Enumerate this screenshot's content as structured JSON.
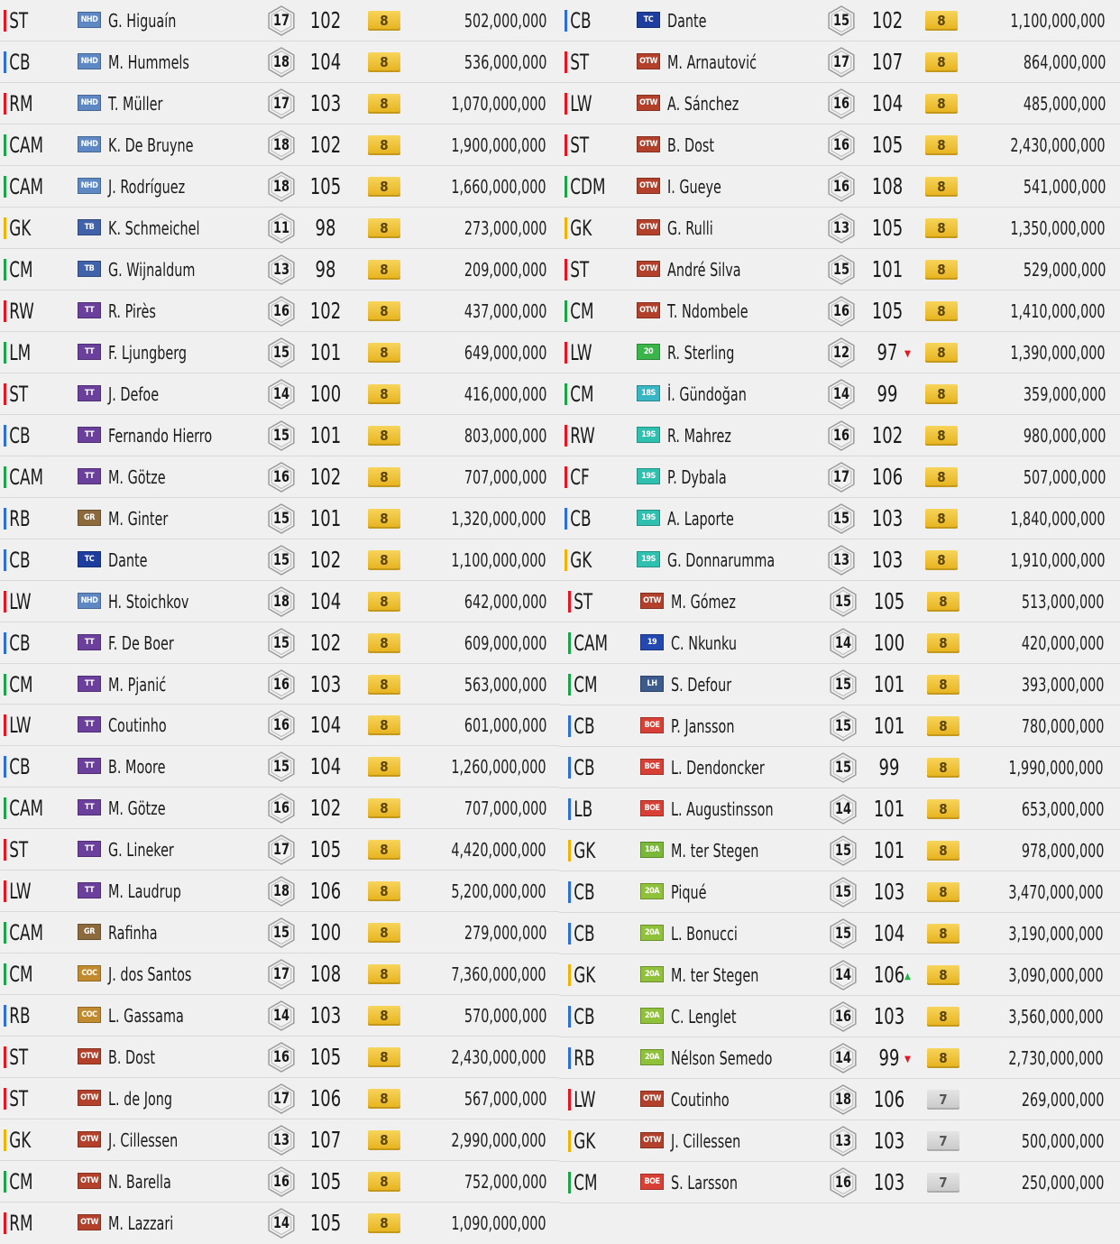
{
  "colors": {
    "position_red": "#e8141f",
    "position_blue": "#2d6fd6",
    "position_green": "#1ea34a",
    "position_yellow": "#f0b400",
    "level_gold": "#e6b21c",
    "level_grey": "#c9c9c9",
    "arrow_down": "#e8141f",
    "arrow_up": "#2ab54a"
  },
  "badge_styles": {
    "NHD": {
      "bg": "#5e88c4"
    },
    "TB": {
      "bg": "#3f62a8"
    },
    "TT": {
      "bg": "#6b3f9c"
    },
    "GR": {
      "bg": "#8c6a3c"
    },
    "TC": {
      "bg": "#1d3e9e"
    },
    "COC": {
      "bg": "#c28a2e"
    },
    "OTW": {
      "bg": "#b3402a"
    },
    "20": {
      "bg": "#3bb54a"
    },
    "18S": {
      "bg": "#38b6c4"
    },
    "19S": {
      "bg": "#2fc0b0"
    },
    "19": {
      "bg": "#2348b0"
    },
    "LH": {
      "bg": "#3c5a8c"
    },
    "BOE": {
      "bg": "#d84035"
    },
    "18A": {
      "bg": "#7ab83a"
    },
    "20A": {
      "bg": "#8fc13a"
    }
  },
  "left_players": [
    {
      "pos": "ST",
      "pc": "red",
      "badge": "NHD",
      "name": "G. Higuaín",
      "lvl": "17",
      "ovr": "102",
      "arrow": "",
      "boost": "8",
      "bc": "gold",
      "price": "502,000,000"
    },
    {
      "pos": "CB",
      "pc": "blue",
      "badge": "NHD",
      "name": "M. Hummels",
      "lvl": "18",
      "ovr": "104",
      "arrow": "",
      "boost": "8",
      "bc": "gold",
      "price": "536,000,000"
    },
    {
      "pos": "RM",
      "pc": "red",
      "badge": "NHD",
      "name": "T. Müller",
      "lvl": "17",
      "ovr": "103",
      "arrow": "",
      "boost": "8",
      "bc": "gold",
      "price": "1,070,000,000"
    },
    {
      "pos": "CAM",
      "pc": "green",
      "badge": "NHD",
      "name": "K. De Bruyne",
      "lvl": "18",
      "ovr": "102",
      "arrow": "",
      "boost": "8",
      "bc": "gold",
      "price": "1,900,000,000"
    },
    {
      "pos": "CAM",
      "pc": "green",
      "badge": "NHD",
      "name": "J. Rodríguez",
      "lvl": "18",
      "ovr": "105",
      "arrow": "",
      "boost": "8",
      "bc": "gold",
      "price": "1,660,000,000"
    },
    {
      "pos": "GK",
      "pc": "yellow",
      "badge": "TB",
      "name": "K. Schmeichel",
      "lvl": "11",
      "ovr": "98",
      "arrow": "",
      "boost": "8",
      "bc": "gold",
      "price": "273,000,000"
    },
    {
      "pos": "CM",
      "pc": "green",
      "badge": "TB",
      "name": "G. Wijnaldum",
      "lvl": "13",
      "ovr": "98",
      "arrow": "",
      "boost": "8",
      "bc": "gold",
      "price": "209,000,000"
    },
    {
      "pos": "RW",
      "pc": "red",
      "badge": "TT",
      "name": "R. Pirès",
      "lvl": "16",
      "ovr": "102",
      "arrow": "",
      "boost": "8",
      "bc": "gold",
      "price": "437,000,000"
    },
    {
      "pos": "LM",
      "pc": "green",
      "badge": "TT",
      "name": "F. Ljungberg",
      "lvl": "15",
      "ovr": "101",
      "arrow": "",
      "boost": "8",
      "bc": "gold",
      "price": "649,000,000"
    },
    {
      "pos": "ST",
      "pc": "red",
      "badge": "TT",
      "name": "J. Defoe",
      "lvl": "14",
      "ovr": "100",
      "arrow": "",
      "boost": "8",
      "bc": "gold",
      "price": "416,000,000"
    },
    {
      "pos": "CB",
      "pc": "blue",
      "badge": "TT",
      "name": "Fernando Hierro",
      "lvl": "15",
      "ovr": "101",
      "arrow": "",
      "boost": "8",
      "bc": "gold",
      "price": "803,000,000"
    },
    {
      "pos": "CAM",
      "pc": "green",
      "badge": "TT",
      "name": "M. Götze",
      "lvl": "16",
      "ovr": "102",
      "arrow": "",
      "boost": "8",
      "bc": "gold",
      "price": "707,000,000"
    },
    {
      "pos": "RB",
      "pc": "blue",
      "badge": "GR",
      "name": "M. Ginter",
      "lvl": "15",
      "ovr": "101",
      "arrow": "",
      "boost": "8",
      "bc": "gold",
      "price": "1,320,000,000"
    },
    {
      "pos": "CB",
      "pc": "blue",
      "badge": "TC",
      "name": "Dante",
      "lvl": "15",
      "ovr": "102",
      "arrow": "",
      "boost": "8",
      "bc": "gold",
      "price": "1,100,000,000"
    },
    {
      "pos": "LW",
      "pc": "red",
      "badge": "NHD",
      "name": "H. Stoichkov",
      "lvl": "18",
      "ovr": "104",
      "arrow": "",
      "boost": "8",
      "bc": "gold",
      "price": "642,000,000"
    },
    {
      "pos": "CB",
      "pc": "blue",
      "badge": "TT",
      "name": "F. De Boer",
      "lvl": "15",
      "ovr": "102",
      "arrow": "",
      "boost": "8",
      "bc": "gold",
      "price": "609,000,000"
    },
    {
      "pos": "CM",
      "pc": "green",
      "badge": "TT",
      "name": "M. Pjanić",
      "lvl": "16",
      "ovr": "103",
      "arrow": "",
      "boost": "8",
      "bc": "gold",
      "price": "563,000,000"
    },
    {
      "pos": "LW",
      "pc": "red",
      "badge": "TT",
      "name": "Coutinho",
      "lvl": "16",
      "ovr": "104",
      "arrow": "",
      "boost": "8",
      "bc": "gold",
      "price": "601,000,000"
    },
    {
      "pos": "CB",
      "pc": "blue",
      "badge": "TT",
      "name": "B. Moore",
      "lvl": "15",
      "ovr": "104",
      "arrow": "",
      "boost": "8",
      "bc": "gold",
      "price": "1,260,000,000"
    },
    {
      "pos": "CAM",
      "pc": "green",
      "badge": "TT",
      "name": "M. Götze",
      "lvl": "16",
      "ovr": "102",
      "arrow": "",
      "boost": "8",
      "bc": "gold",
      "price": "707,000,000"
    },
    {
      "pos": "ST",
      "pc": "red",
      "badge": "TT",
      "name": "G. Lineker",
      "lvl": "17",
      "ovr": "105",
      "arrow": "",
      "boost": "8",
      "bc": "gold",
      "price": "4,420,000,000"
    },
    {
      "pos": "LW",
      "pc": "red",
      "badge": "TT",
      "name": "M. Laudrup",
      "lvl": "18",
      "ovr": "106",
      "arrow": "",
      "boost": "8",
      "bc": "gold",
      "price": "5,200,000,000"
    },
    {
      "pos": "CAM",
      "pc": "green",
      "badge": "GR",
      "name": "Rafinha",
      "lvl": "15",
      "ovr": "100",
      "arrow": "",
      "boost": "8",
      "bc": "gold",
      "price": "279,000,000"
    },
    {
      "pos": "CM",
      "pc": "green",
      "badge": "COC",
      "name": "J. dos Santos",
      "lvl": "17",
      "ovr": "108",
      "arrow": "",
      "boost": "8",
      "bc": "gold",
      "price": "7,360,000,000"
    },
    {
      "pos": "RB",
      "pc": "blue",
      "badge": "COC",
      "name": "L. Gassama",
      "lvl": "14",
      "ovr": "103",
      "arrow": "",
      "boost": "8",
      "bc": "gold",
      "price": "570,000,000"
    },
    {
      "pos": "ST",
      "pc": "red",
      "badge": "OTW",
      "name": "B. Dost",
      "lvl": "16",
      "ovr": "105",
      "arrow": "",
      "boost": "8",
      "bc": "gold",
      "price": "2,430,000,000"
    },
    {
      "pos": "ST",
      "pc": "red",
      "badge": "OTW",
      "name": "L. de Jong",
      "lvl": "17",
      "ovr": "106",
      "arrow": "",
      "boost": "8",
      "bc": "gold",
      "price": "567,000,000"
    },
    {
      "pos": "GK",
      "pc": "yellow",
      "badge": "OTW",
      "name": "J. Cillessen",
      "lvl": "13",
      "ovr": "107",
      "arrow": "",
      "boost": "8",
      "bc": "gold",
      "price": "2,990,000,000"
    },
    {
      "pos": "CM",
      "pc": "green",
      "badge": "OTW",
      "name": "N. Barella",
      "lvl": "16",
      "ovr": "105",
      "arrow": "",
      "boost": "8",
      "bc": "gold",
      "price": "752,000,000"
    },
    {
      "pos": "RM",
      "pc": "red",
      "badge": "OTW",
      "name": "M. Lazzari",
      "lvl": "14",
      "ovr": "105",
      "arrow": "",
      "boost": "8",
      "bc": "gold",
      "price": "1,090,000,000"
    }
  ],
  "right_players": [
    {
      "pos": "CB",
      "pc": "blue",
      "badge": "TC",
      "name": "Dante",
      "lvl": "15",
      "ovr": "102",
      "arrow": "",
      "boost": "8",
      "bc": "gold",
      "price": "1,100,000,000"
    },
    {
      "pos": "ST",
      "pc": "red",
      "badge": "OTW",
      "name": "M. Arnautović",
      "lvl": "17",
      "ovr": "107",
      "arrow": "",
      "boost": "8",
      "bc": "gold",
      "price": "864,000,000"
    },
    {
      "pos": "LW",
      "pc": "red",
      "badge": "OTW",
      "name": "A. Sánchez",
      "lvl": "16",
      "ovr": "104",
      "arrow": "",
      "boost": "8",
      "bc": "gold",
      "price": "485,000,000"
    },
    {
      "pos": "ST",
      "pc": "red",
      "badge": "OTW",
      "name": "B. Dost",
      "lvl": "16",
      "ovr": "105",
      "arrow": "",
      "boost": "8",
      "bc": "gold",
      "price": "2,430,000,000"
    },
    {
      "pos": "CDM",
      "pc": "green",
      "badge": "OTW",
      "name": "I. Gueye",
      "lvl": "16",
      "ovr": "108",
      "arrow": "",
      "boost": "8",
      "bc": "gold",
      "price": "541,000,000"
    },
    {
      "pos": "GK",
      "pc": "yellow",
      "badge": "OTW",
      "name": "G. Rulli",
      "lvl": "13",
      "ovr": "105",
      "arrow": "",
      "boost": "8",
      "bc": "gold",
      "price": "1,350,000,000"
    },
    {
      "pos": "ST",
      "pc": "red",
      "badge": "OTW",
      "name": "André Silva",
      "lvl": "15",
      "ovr": "101",
      "arrow": "",
      "boost": "8",
      "bc": "gold",
      "price": "529,000,000"
    },
    {
      "pos": "CM",
      "pc": "green",
      "badge": "OTW",
      "name": "T. Ndombele",
      "lvl": "16",
      "ovr": "105",
      "arrow": "",
      "boost": "8",
      "bc": "gold",
      "price": "1,410,000,000"
    },
    {
      "pos": "LW",
      "pc": "red",
      "badge": "20",
      "name": "R. Sterling",
      "lvl": "12",
      "ovr": "97",
      "arrow": "down",
      "boost": "8",
      "bc": "gold",
      "price": "1,390,000,000"
    },
    {
      "pos": "CM",
      "pc": "green",
      "badge": "18S",
      "name": "İ. Gündoğan",
      "lvl": "14",
      "ovr": "99",
      "arrow": "",
      "boost": "8",
      "bc": "gold",
      "price": "359,000,000"
    },
    {
      "pos": "RW",
      "pc": "red",
      "badge": "19S",
      "name": "R. Mahrez",
      "lvl": "16",
      "ovr": "102",
      "arrow": "",
      "boost": "8",
      "bc": "gold",
      "price": "980,000,000"
    },
    {
      "pos": "CF",
      "pc": "red",
      "badge": "19S",
      "name": "P. Dybala",
      "lvl": "17",
      "ovr": "106",
      "arrow": "",
      "boost": "8",
      "bc": "gold",
      "price": "507,000,000"
    },
    {
      "pos": "CB",
      "pc": "blue",
      "badge": "19S",
      "name": "A. Laporte",
      "lvl": "15",
      "ovr": "103",
      "arrow": "",
      "boost": "8",
      "bc": "gold",
      "price": "1,840,000,000"
    },
    {
      "pos": "GK",
      "pc": "yellow",
      "badge": "19S",
      "name": "G. Donnarumma",
      "lvl": "13",
      "ovr": "103",
      "arrow": "",
      "boost": "8",
      "bc": "gold",
      "price": "1,910,000,000"
    },
    {
      "pos": "ST",
      "pc": "red",
      "badge": "OTW",
      "name": "M. Gómez",
      "lvl": "15",
      "ovr": "105",
      "arrow": "",
      "boost": "8",
      "bc": "gold",
      "price": "513,000,000",
      "lower": true
    },
    {
      "pos": "CAM",
      "pc": "green",
      "badge": "19",
      "name": "C. Nkunku",
      "lvl": "14",
      "ovr": "100",
      "arrow": "",
      "boost": "8",
      "bc": "gold",
      "price": "420,000,000",
      "lower": true
    },
    {
      "pos": "CM",
      "pc": "green",
      "badge": "LH",
      "name": "S. Defour",
      "lvl": "15",
      "ovr": "101",
      "arrow": "",
      "boost": "8",
      "bc": "gold",
      "price": "393,000,000",
      "lower": true
    },
    {
      "pos": "CB",
      "pc": "blue",
      "badge": "BOE",
      "name": "P. Jansson",
      "lvl": "15",
      "ovr": "101",
      "arrow": "",
      "boost": "8",
      "bc": "gold",
      "price": "780,000,000",
      "lower": true
    },
    {
      "pos": "CB",
      "pc": "blue",
      "badge": "BOE",
      "name": "L. Dendoncker",
      "lvl": "15",
      "ovr": "99",
      "arrow": "",
      "boost": "8",
      "bc": "gold",
      "price": "1,990,000,000",
      "lower": true
    },
    {
      "pos": "LB",
      "pc": "blue",
      "badge": "BOE",
      "name": "L. Augustinsson",
      "lvl": "14",
      "ovr": "101",
      "arrow": "",
      "boost": "8",
      "bc": "gold",
      "price": "653,000,000",
      "lower": true
    },
    {
      "pos": "GK",
      "pc": "yellow",
      "badge": "18A",
      "name": "M. ter Stegen",
      "lvl": "15",
      "ovr": "101",
      "arrow": "",
      "boost": "8",
      "bc": "gold",
      "price": "978,000,000",
      "lower": true
    },
    {
      "pos": "CB",
      "pc": "blue",
      "badge": "20A",
      "name": "Piqué",
      "lvl": "15",
      "ovr": "103",
      "arrow": "",
      "boost": "8",
      "bc": "gold",
      "price": "3,470,000,000",
      "lower": true
    },
    {
      "pos": "CB",
      "pc": "blue",
      "badge": "20A",
      "name": "L. Bonucci",
      "lvl": "15",
      "ovr": "104",
      "arrow": "",
      "boost": "8",
      "bc": "gold",
      "price": "3,190,000,000",
      "lower": true
    },
    {
      "pos": "GK",
      "pc": "yellow",
      "badge": "20A",
      "name": "M. ter Stegen",
      "lvl": "14",
      "ovr": "106",
      "arrow": "up",
      "boost": "8",
      "bc": "gold",
      "price": "3,090,000,000",
      "lower": true
    },
    {
      "pos": "CB",
      "pc": "blue",
      "badge": "20A",
      "name": "C. Lenglet",
      "lvl": "16",
      "ovr": "103",
      "arrow": "",
      "boost": "8",
      "bc": "gold",
      "price": "3,560,000,000",
      "lower": true
    },
    {
      "pos": "RB",
      "pc": "blue",
      "badge": "20A",
      "name": "Nélson Semedo",
      "lvl": "14",
      "ovr": "99",
      "arrow": "down",
      "boost": "8",
      "bc": "gold",
      "price": "2,730,000,000",
      "lower": true
    },
    {
      "pos": "LW",
      "pc": "red",
      "badge": "OTW",
      "name": "Coutinho",
      "lvl": "18",
      "ovr": "106",
      "arrow": "",
      "boost": "7",
      "bc": "grey",
      "price": "269,000,000",
      "lower": true
    },
    {
      "pos": "GK",
      "pc": "yellow",
      "badge": "OTW",
      "name": "J. Cillessen",
      "lvl": "13",
      "ovr": "103",
      "arrow": "",
      "boost": "7",
      "bc": "grey",
      "price": "500,000,000",
      "lower": true
    },
    {
      "pos": "CM",
      "pc": "green",
      "badge": "BOE",
      "name": "S. Larsson",
      "lvl": "16",
      "ovr": "103",
      "arrow": "",
      "boost": "7",
      "bc": "grey",
      "price": "250,000,000",
      "lower": true
    }
  ]
}
